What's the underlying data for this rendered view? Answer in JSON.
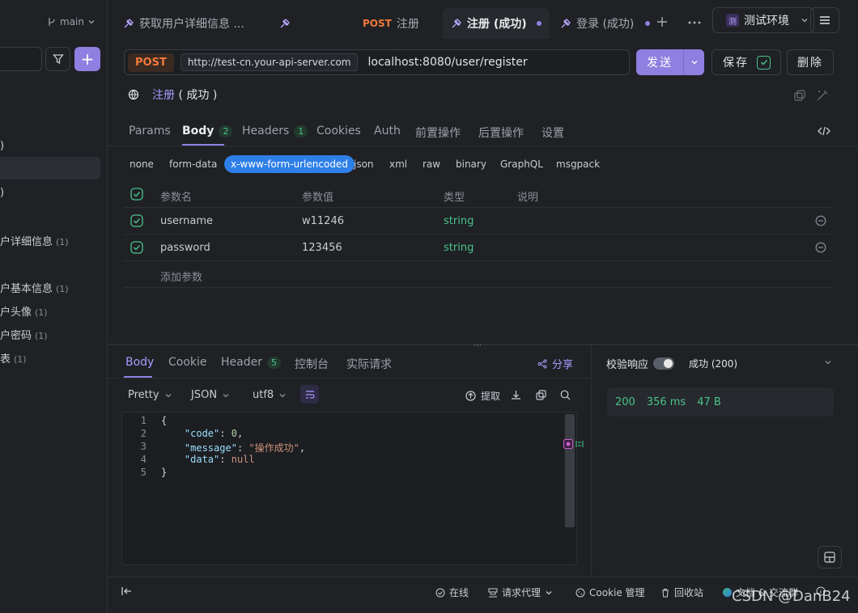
{
  "sidebar": {
    "branch": "main",
    "items": [
      {
        "label": ")",
        "count": ""
      },
      {
        "label": ")",
        "count": ""
      },
      {
        "label": "户详细信息",
        "count": "(1)"
      },
      {
        "label": "户基本信息",
        "count": "(1)"
      },
      {
        "label": "户头像",
        "count": "(1)"
      },
      {
        "label": "户密码",
        "count": "(1)"
      },
      {
        "label": "表",
        "count": "(1)"
      }
    ]
  },
  "tabs": [
    {
      "label": "获取用户详细信息 ...",
      "method": ""
    },
    {
      "label": "",
      "method": ""
    },
    {
      "label": "注册",
      "method": "POST"
    },
    {
      "label": "注册 (成功)",
      "method": ""
    },
    {
      "label": "登录 (成功)",
      "method": ""
    }
  ],
  "environment": {
    "badge": "测",
    "label": "测试环境"
  },
  "request": {
    "method": "POST",
    "base_url": "http://test-cn.your-api-server.com",
    "path": "localhost:8080/user/register",
    "send_label": "发送",
    "save_label": "保存",
    "delete_label": "删除",
    "name": "注册",
    "name_suffix": "( 成功 )"
  },
  "request_tabs": [
    {
      "label": "Params",
      "count": ""
    },
    {
      "label": "Body",
      "count": "2"
    },
    {
      "label": "Headers",
      "count": "1"
    },
    {
      "label": "Cookies",
      "count": ""
    },
    {
      "label": "Auth",
      "count": ""
    },
    {
      "label": "前置操作",
      "count": ""
    },
    {
      "label": "后置操作",
      "count": ""
    },
    {
      "label": "设置",
      "count": ""
    }
  ],
  "body_types": [
    "none",
    "form-data",
    "x-www-form-urlencoded",
    "json",
    "xml",
    "raw",
    "binary",
    "GraphQL",
    "msgpack"
  ],
  "params": {
    "headers": [
      "参数名",
      "参数值",
      "类型",
      "说明"
    ],
    "rows": [
      {
        "name": "username",
        "value": "w11246",
        "type": "string"
      },
      {
        "name": "password",
        "value": "123456",
        "type": "string"
      }
    ],
    "add_label": "添加参数"
  },
  "response": {
    "tabs": [
      {
        "label": "Body",
        "count": ""
      },
      {
        "label": "Cookie",
        "count": ""
      },
      {
        "label": "Header",
        "count": "5"
      },
      {
        "label": "控制台",
        "count": ""
      },
      {
        "label": "实际请求",
        "count": ""
      }
    ],
    "share_label": "分享",
    "format": "Pretty",
    "lang": "JSON",
    "encoding": "utf8",
    "extract_label": "提取",
    "code_lines": [
      "1",
      "2",
      "3",
      "4",
      "5"
    ],
    "code": {
      "open": "{",
      "code_key": "\"code\"",
      "code_val": "0",
      "message_key": "\"message\"",
      "message_val": "\"操作成功\"",
      "data_key": "\"data\"",
      "data_val": "null",
      "close": "}"
    },
    "validate_label": "校验响应",
    "status_label": "成功 (200)",
    "status_code": "200",
    "time": "356 ms",
    "size": "47 B"
  },
  "statusbar": {
    "online": "在线",
    "proxy": "请求代理",
    "cookie": "Cookie 管理",
    "trash": "回收站",
    "docs": "文档 & 交流群"
  },
  "watermark": "CSDN @DanB24"
}
